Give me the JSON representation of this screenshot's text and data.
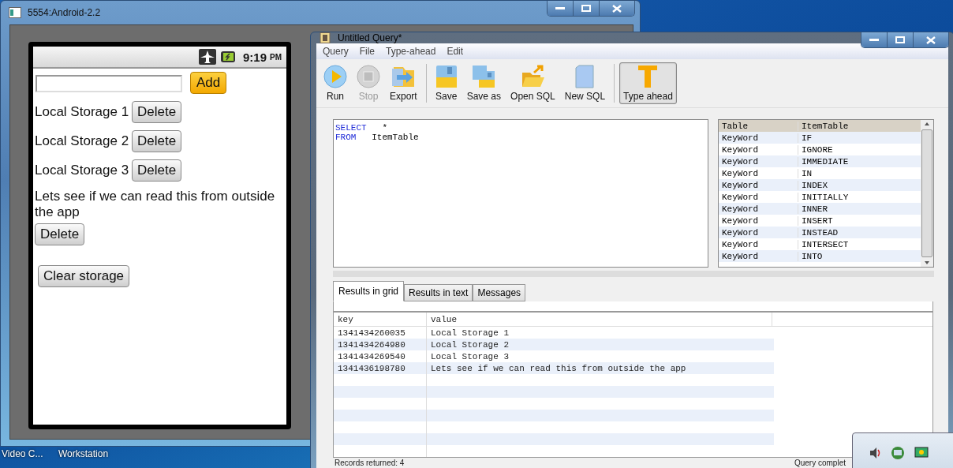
{
  "desktop_icons": [
    {
      "label": "Video C..."
    },
    {
      "label": "Workstation"
    }
  ],
  "emulator": {
    "title": "5554:Android-2.2",
    "time": "9:19",
    "ampm": "PM",
    "add_button": "Add",
    "items": [
      {
        "text": "Local Storage 1",
        "button": "Delete"
      },
      {
        "text": "Local Storage 2",
        "button": "Delete"
      },
      {
        "text": "Local Storage 3",
        "button": "Delete"
      },
      {
        "text": "Lets see if we can read this from outside the app",
        "button": "Delete"
      }
    ],
    "clear_button": "Clear storage"
  },
  "query_window": {
    "title": "Untitled Query*",
    "menu": [
      "Query",
      "File",
      "Type-ahead",
      "Edit"
    ],
    "toolbar": [
      [
        {
          "label": "Run",
          "kind": "run",
          "disabled": false,
          "on": false
        },
        {
          "label": "Stop",
          "kind": "stop",
          "disabled": true,
          "on": false
        },
        {
          "label": "Export",
          "kind": "export",
          "disabled": false,
          "on": false
        }
      ],
      [
        {
          "label": "Save",
          "kind": "save",
          "disabled": false,
          "on": false
        },
        {
          "label": "Save as",
          "kind": "saveas",
          "disabled": false,
          "on": false
        },
        {
          "label": "Open SQL",
          "kind": "open",
          "disabled": false,
          "on": false
        },
        {
          "label": "New SQL",
          "kind": "new",
          "disabled": false,
          "on": false
        }
      ],
      [
        {
          "label": "Type ahead",
          "kind": "type",
          "disabled": false,
          "on": true
        }
      ]
    ],
    "editor": [
      {
        "keyword": "SELECT",
        "rest": "*"
      },
      {
        "keyword": "FROM",
        "rest": "ItemTable"
      }
    ],
    "keyword_list": {
      "columns": [
        "Table",
        "ItemTable"
      ],
      "rows": [
        [
          "KeyWord",
          "IF"
        ],
        [
          "KeyWord",
          "IGNORE"
        ],
        [
          "KeyWord",
          "IMMEDIATE"
        ],
        [
          "KeyWord",
          "IN"
        ],
        [
          "KeyWord",
          "INDEX"
        ],
        [
          "KeyWord",
          "INITIALLY"
        ],
        [
          "KeyWord",
          "INNER"
        ],
        [
          "KeyWord",
          "INSERT"
        ],
        [
          "KeyWord",
          "INSTEAD"
        ],
        [
          "KeyWord",
          "INTERSECT"
        ],
        [
          "KeyWord",
          "INTO"
        ]
      ]
    },
    "result_tabs": [
      {
        "label": "Results in grid",
        "selected": true
      },
      {
        "label": "Results in text",
        "selected": false
      },
      {
        "label": "Messages",
        "selected": false
      }
    ],
    "grid": {
      "columns": [
        "key",
        "value"
      ],
      "rows": [
        [
          "1341434260035",
          "Local Storage 1"
        ],
        [
          "1341434264980",
          "Local Storage 2"
        ],
        [
          "1341434269540",
          "Local Storage 3"
        ],
        [
          "1341436198780",
          "Lets see if we can read this from outside the app"
        ]
      ]
    },
    "status_bar": {
      "left": "Records returned: 4",
      "right": "Query complet"
    }
  }
}
